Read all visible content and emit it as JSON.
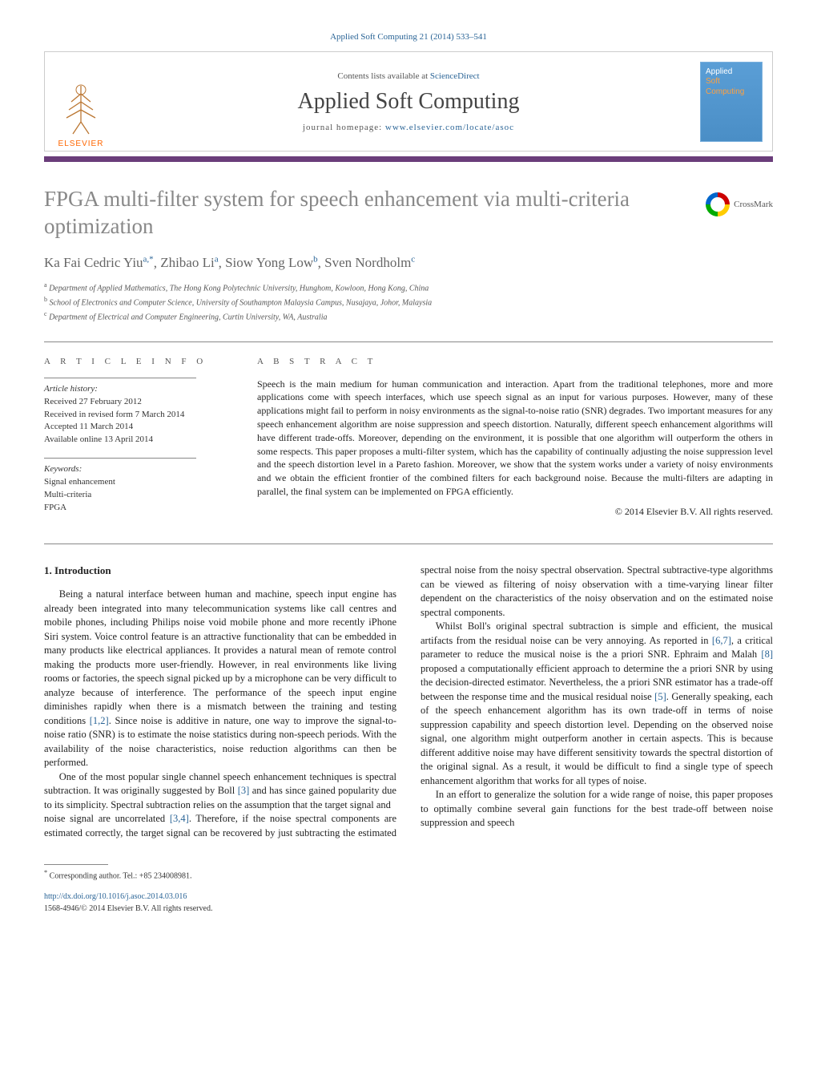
{
  "header": {
    "citation": "Applied Soft Computing 21 (2014) 533–541",
    "contents_prefix": "Contents lists available at ",
    "contents_link": "ScienceDirect",
    "journal_name": "Applied Soft Computing",
    "homepage_prefix": "journal homepage: ",
    "homepage_url": "www.elsevier.com/locate/asoc",
    "publisher": "ELSEVIER",
    "cover_line1": "Applied",
    "cover_line2": "Soft",
    "cover_line3": "Computing"
  },
  "crossmark": "CrossMark",
  "title": "FPGA multi-filter system for speech enhancement via multi-criteria optimization",
  "authors": [
    {
      "name": "Ka Fai Cedric Yiu",
      "sup": "a,*"
    },
    {
      "name": "Zhibao Li",
      "sup": "a"
    },
    {
      "name": "Siow Yong Low",
      "sup": "b"
    },
    {
      "name": "Sven Nordholm",
      "sup": "c"
    }
  ],
  "affiliations": [
    {
      "sup": "a",
      "text": "Department of Applied Mathematics, The Hong Kong Polytechnic University, Hunghom, Kowloon, Hong Kong, China"
    },
    {
      "sup": "b",
      "text": "School of Electronics and Computer Science, University of Southampton Malaysia Campus, Nusajaya, Johor, Malaysia"
    },
    {
      "sup": "c",
      "text": "Department of Electrical and Computer Engineering, Curtin University, WA, Australia"
    }
  ],
  "article_info": {
    "heading": "a r t i c l e   i n f o",
    "history_label": "Article history:",
    "received": "Received 27 February 2012",
    "revised": "Received in revised form 7 March 2014",
    "accepted": "Accepted 11 March 2014",
    "online": "Available online 13 April 2014",
    "keywords_label": "Keywords:",
    "keywords": [
      "Signal enhancement",
      "Multi-criteria",
      "FPGA"
    ]
  },
  "abstract": {
    "heading": "a b s t r a c t",
    "text": "Speech is the main medium for human communication and interaction. Apart from the traditional telephones, more and more applications come with speech interfaces, which use speech signal as an input for various purposes. However, many of these applications might fail to perform in noisy environments as the signal-to-noise ratio (SNR) degrades. Two important measures for any speech enhancement algorithm are noise suppression and speech distortion. Naturally, different speech enhancement algorithms will have different trade-offs. Moreover, depending on the environment, it is possible that one algorithm will outperform the others in some respects. This paper proposes a multi-filter system, which has the capability of continually adjusting the noise suppression level and the speech distortion level in a Pareto fashion. Moreover, we show that the system works under a variety of noisy environments and we obtain the efficient frontier of the combined filters for each background noise. Because the multi-filters are adapting in parallel, the final system can be implemented on FPGA efficiently.",
    "copyright": "© 2014 Elsevier B.V. All rights reserved."
  },
  "body": {
    "section1_heading": "1.  Introduction",
    "p1": "Being a natural interface between human and machine, speech input engine has already been integrated into many telecommunication systems like call centres and mobile phones, including Philips noise void mobile phone and more recently iPhone Siri system. Voice control feature is an attractive functionality that can be embedded in many products like electrical appliances. It provides a natural mean of remote control making the products more user-friendly. However, in real environments like living rooms or factories, the speech signal picked up by a microphone can be very difficult to analyze because of interference. The performance of the speech input engine diminishes rapidly when there is a mismatch between the training and testing conditions ",
    "p1_cite": "[1,2]",
    "p1b": ". Since noise is additive in nature, one way to improve the signal-to-noise ratio (SNR) is to estimate the noise statistics during non-speech periods. With the availability of the noise characteristics, noise reduction algorithms can then be performed.",
    "p2": "One of the most popular single channel speech enhancement techniques is spectral subtraction. It was originally suggested by Boll ",
    "p2_cite": "[3]",
    "p2b": " and has since gained popularity due to its simplicity. Spectral subtraction relies on the assumption that the target signal and",
    "p3a": "noise signal are uncorrelated ",
    "p3_cite1": "[3,4]",
    "p3b": ". Therefore, if the noise spectral components are estimated correctly, the target signal can be recovered by just subtracting the estimated spectral noise from the noisy spectral observation. Spectral subtractive-type algorithms can be viewed as filtering of noisy observation with a time-varying linear filter dependent on the characteristics of the noisy observation and on the estimated noise spectral components.",
    "p4a": "Whilst Boll's original spectral subtraction is simple and efficient, the musical artifacts from the residual noise can be very annoying. As reported in ",
    "p4_cite1": "[6,7]",
    "p4b": ", a critical parameter to reduce the musical noise is the a priori SNR. Ephraim and Malah ",
    "p4_cite2": "[8]",
    "p4c": " proposed a computationally efficient approach to determine the a priori SNR by using the decision-directed estimator. Nevertheless, the a priori SNR estimator has a trade-off between the response time and the musical residual noise ",
    "p4_cite3": "[5]",
    "p4d": ". Generally speaking, each of the speech enhancement algorithm has its own trade-off in terms of noise suppression capability and speech distortion level. Depending on the observed noise signal, one algorithm might outperform another in certain aspects. This is because different additive noise may have different sensitivity towards the spectral distortion of the original signal. As a result, it would be difficult to find a single type of speech enhancement algorithm that works for all types of noise.",
    "p5": "In an effort to generalize the solution for a wide range of noise, this paper proposes to optimally combine several gain functions for the best trade-off between noise suppression and speech"
  },
  "footer": {
    "corresponding": "Corresponding author. Tel.: +85 234008981.",
    "doi": "http://dx.doi.org/10.1016/j.asoc.2014.03.016",
    "issn_copy": "1568-4946/© 2014 Elsevier B.V. All rights reserved."
  }
}
